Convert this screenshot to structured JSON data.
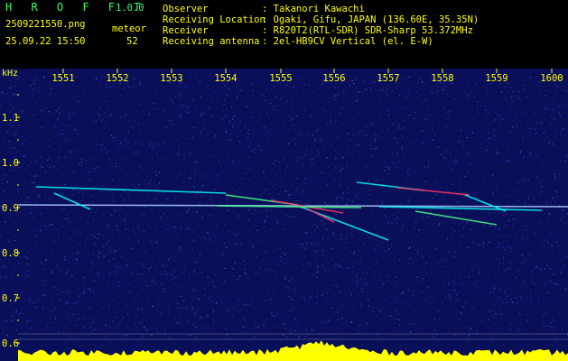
{
  "app": {
    "name": "H R O F F T",
    "version": "1.0.0",
    "filename": "2509221550.png",
    "datetime": "25.09.22 15:50",
    "counter_label": "meteor",
    "counter_value": "52"
  },
  "info": {
    "labels": [
      "Observer",
      "Receiving Location",
      "Receiver",
      "Receiving antenna"
    ],
    "values": [
      ": Takanori Kawachi",
      ": Ogaki, Gifu, JAPAN (136.60E, 35.35N)",
      ": R820T2(RTL-SDR) SDR-Sharp 53.372MHz",
      ": 2el-HB9CV Vertical (el. E-W)"
    ]
  },
  "spectrogram": {
    "y_unit": "kHz",
    "x_ticks": [
      "1551",
      "1552",
      "1553",
      "1554",
      "1555",
      "1556",
      "1557",
      "1558",
      "1559",
      "1600"
    ],
    "y_ticks": [
      "1.1",
      "1.0",
      "0.9",
      "0.8",
      "0.7",
      "0.6"
    ],
    "background_color": "#0a0f5a",
    "noise_colors": [
      "#2233cc",
      "#3355ff",
      "#5577ff"
    ],
    "carrier_color": "#aaccff",
    "trace_colors": [
      "#00ffff",
      "#44ff88",
      "#ff3366",
      "#ffffff"
    ],
    "level_color": "#ffff00"
  }
}
